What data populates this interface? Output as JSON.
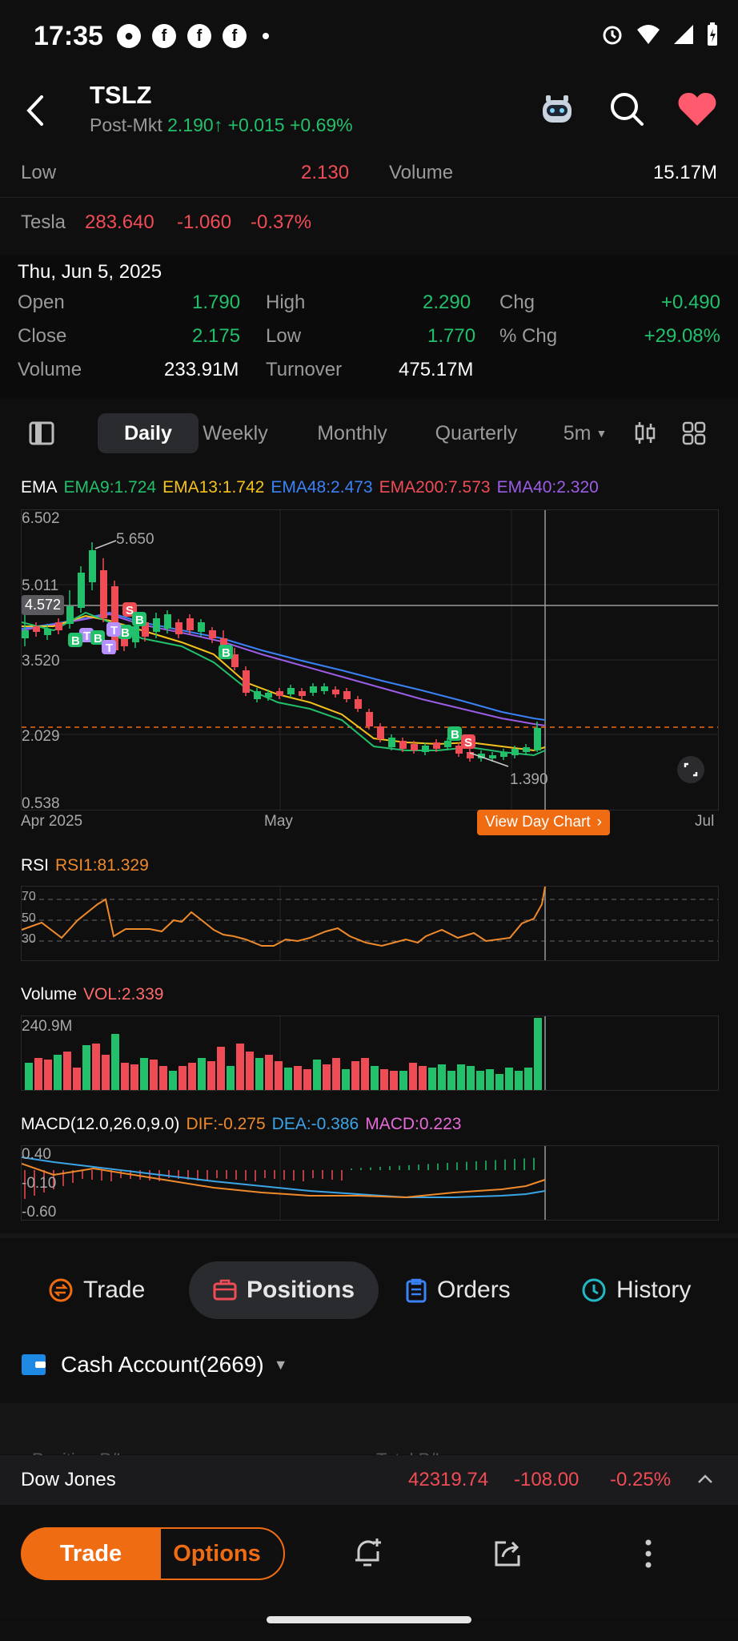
{
  "status_bar": {
    "time": "17:35"
  },
  "header": {
    "ticker": "TSLZ",
    "session": "Post-Mkt",
    "price": "2.190",
    "arrow": "↑",
    "change": "+0.015",
    "change_pct": "+0.69%"
  },
  "quote": {
    "low_label": "Low",
    "low_value": "2.130",
    "volume_label": "Volume",
    "volume_value": "15.17M",
    "underlying_name": "Tesla",
    "underlying_price": "283.640",
    "underlying_change": "-1.060",
    "underlying_pct": "-0.37%"
  },
  "day": {
    "date": "Thu, Jun 5, 2025",
    "open_label": "Open",
    "open": "1.790",
    "high_label": "High",
    "high": "2.290",
    "chg_label": "Chg",
    "chg": "+0.490",
    "close_label": "Close",
    "close": "2.175",
    "low_label": "Low",
    "low": "1.770",
    "pchg_label": "% Chg",
    "pchg": "+29.08%",
    "volume_label": "Volume",
    "volume": "233.91M",
    "turnover_label": "Turnover",
    "turnover": "475.17M"
  },
  "tabs": {
    "daily": "Daily",
    "weekly": "Weekly",
    "monthly": "Monthly",
    "quarterly": "Quarterly",
    "interval": "5m"
  },
  "ema": {
    "label": "EMA",
    "ema9": "EMA9:1.724",
    "ema13": "EMA13:1.742",
    "ema48": "EMA48:2.473",
    "ema200": "EMA200:7.573",
    "ema40": "EMA40:2.320",
    "colors": {
      "ema9": "#22c06b",
      "ema13": "#f5c21b",
      "ema48": "#3b82f6",
      "ema200": "#f04c56",
      "ema40": "#9b5de5"
    }
  },
  "main_chart": {
    "y_labels": [
      "6.502",
      "5.011",
      "3.520",
      "2.029",
      "0.538"
    ],
    "x_labels": [
      "Apr 2025",
      "May",
      "Jul"
    ],
    "crosshair_value": "4.572",
    "high_marker": "5.650",
    "low_marker": "1.390",
    "view_day_chart": "View Day Chart"
  },
  "rsi": {
    "label": "RSI",
    "value": "RSI1:81.329",
    "levels": [
      "70",
      "50",
      "30"
    ]
  },
  "volume": {
    "label": "Volume",
    "value": "VOL:2.339",
    "max_label": "240.9M"
  },
  "macd": {
    "label": "MACD(12.0,26.0,9.0)",
    "dif": "DIF:-0.275",
    "dea": "DEA:-0.386",
    "macd": "MACD:0.223",
    "y_labels": [
      "0.40",
      "-0.10",
      "-0.60"
    ]
  },
  "bottom_tabs": {
    "trade": "Trade",
    "positions": "Positions",
    "orders": "Orders",
    "history": "History"
  },
  "account": {
    "name": "Cash Account(2669)"
  },
  "partial": {
    "position_pl": "Position P/L",
    "total_pl": "Total P/L"
  },
  "index_bar": {
    "name": "Dow Jones",
    "value": "42319.74",
    "change": "-108.00",
    "pct": "-0.25%"
  },
  "footer": {
    "trade": "Trade",
    "options": "Options"
  }
}
